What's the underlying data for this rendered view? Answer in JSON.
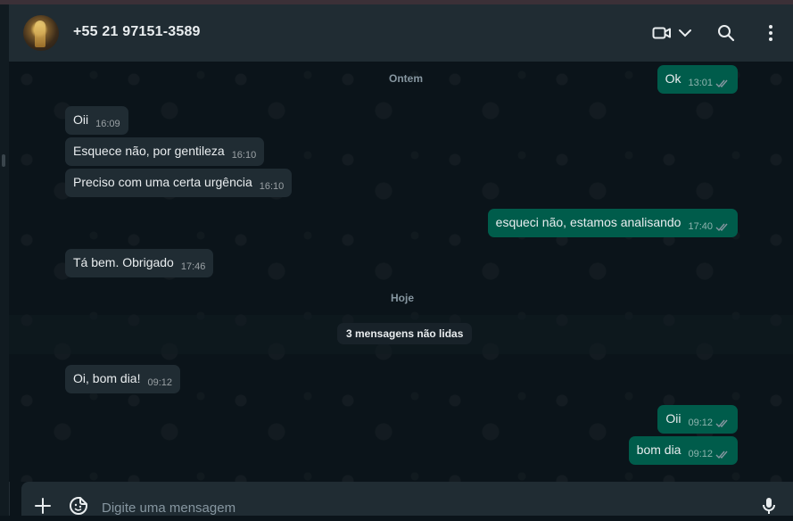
{
  "header": {
    "contact_name": "+55 21 97151-3589"
  },
  "chat": {
    "date_labels": {
      "yesterday": "Ontem",
      "today": "Hoje"
    },
    "unread_label": "3 mensagens não lidas",
    "messages": [
      {
        "dir": "out",
        "text": "Ok",
        "time": "13:01",
        "status": "read"
      },
      {
        "dir": "in",
        "text": "Oii",
        "time": "16:09"
      },
      {
        "dir": "in",
        "text": "Esquece não, por gentileza",
        "time": "16:10"
      },
      {
        "dir": "in",
        "text": "Preciso com uma certa urgência",
        "time": "16:10"
      },
      {
        "dir": "out",
        "text": "esqueci não, estamos analisando",
        "time": "17:40",
        "status": "read"
      },
      {
        "dir": "in",
        "text": "Tá bem. Obrigado",
        "time": "17:46"
      },
      {
        "dir": "in",
        "text": "Oi, bom dia!",
        "time": "09:12"
      },
      {
        "dir": "out",
        "text": "Oii",
        "time": "09:12",
        "status": "read"
      },
      {
        "dir": "out",
        "text": "bom dia",
        "time": "09:12",
        "status": "read"
      }
    ]
  },
  "composer": {
    "placeholder": "Digite uma mensagem"
  },
  "icons": {
    "video": "video-camera-icon",
    "dropdown": "chevron-down-icon",
    "search": "search-icon",
    "menu": "kebab-menu-icon",
    "attach": "plus-icon",
    "sticker": "sticker-icon",
    "mic": "microphone-icon",
    "ticks": "double-check-icon"
  },
  "colors": {
    "background": "#0b141a",
    "header": "#202c33",
    "incoming": "#202c33",
    "outgoing": "#005c4b",
    "text": "#e9edef",
    "muted": "#8696a0"
  }
}
